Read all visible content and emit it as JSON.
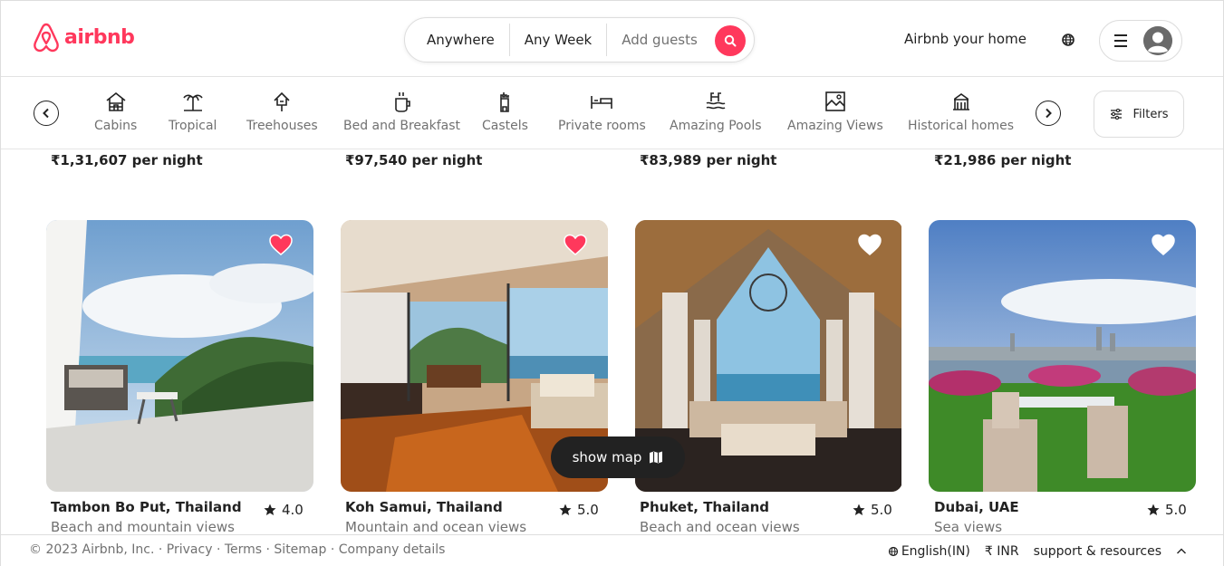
{
  "header": {
    "logo_text": "airbnb",
    "search": {
      "anywhere": "Anywhere",
      "any_week": "Any Week",
      "add_guests": "Add guests"
    },
    "host_link": "Airbnb your home"
  },
  "categories": [
    {
      "label": "Cabins",
      "icon": "cabin-icon"
    },
    {
      "label": "Tropical",
      "icon": "tropical-icon"
    },
    {
      "label": "Treehouses",
      "icon": "treehouse-icon"
    },
    {
      "label": "Bed and Breakfast",
      "icon": "bed-breakfast-icon"
    },
    {
      "label": "Castels",
      "icon": "castle-icon"
    },
    {
      "label": "Private rooms",
      "icon": "private-room-icon"
    },
    {
      "label": "Amazing Pools",
      "icon": "pool-icon"
    },
    {
      "label": "Amazing Views",
      "icon": "view-icon"
    },
    {
      "label": "Historical homes",
      "icon": "historical-home-icon"
    }
  ],
  "filters_label": "Filters",
  "previous_row_prices": [
    "₹1,31,607 per night",
    "₹97,540 per night",
    "₹83,989 per night",
    "₹21,986 per night"
  ],
  "listings": [
    {
      "title": "Tambon Bo Put, Thailand",
      "rating": "4.0",
      "subtitle": "Beach and mountain views",
      "favorited": true
    },
    {
      "title": "Koh Samui, Thailand",
      "rating": "5.0",
      "subtitle": "Mountain and ocean views",
      "favorited": true
    },
    {
      "title": "Phuket, Thailand",
      "rating": "5.0",
      "subtitle": "Beach and ocean views",
      "favorited": false
    },
    {
      "title": "Dubai, UAE",
      "rating": "5.0",
      "subtitle": "Sea views",
      "favorited": false
    }
  ],
  "show_map_label": "show map",
  "footer": {
    "copyright": "© 2023 Airbnb, Inc. · Privacy · Terms · Sitemap · Company details",
    "language": "English(IN)",
    "currency": "₹ INR",
    "support": "support & resources"
  },
  "colors": {
    "brand": "#FF385C",
    "text": "#222222",
    "muted": "#717171"
  }
}
